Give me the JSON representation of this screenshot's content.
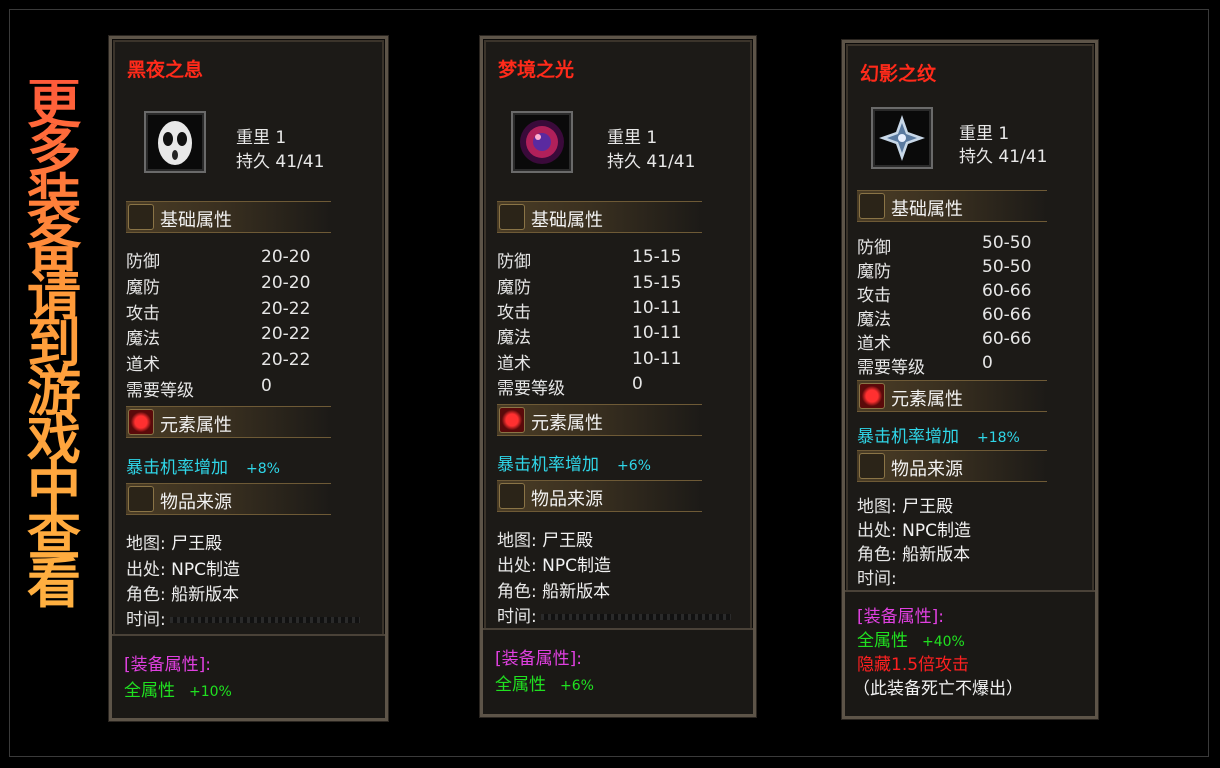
{
  "side_text": "更多装备请到游戏中查看",
  "labels": {
    "weight": "重里",
    "durability": "持久",
    "basic_attrs": "基础属性",
    "element_attrs": "元素属性",
    "item_source": "物品来源",
    "equip_attrs": "[装备属性]:",
    "all_attrs": "全属性",
    "crit_increase": "暴击机率增加",
    "map": "地图:",
    "origin": "出处:",
    "role": "角色:",
    "time": "时间:"
  },
  "stat_names": [
    "防御",
    "魔防",
    "攻击",
    "魔法",
    "道术",
    "需要等级"
  ],
  "items": [
    {
      "name": "黑夜之息",
      "icon": "skull-mask-icon",
      "weight": "1",
      "durability": "41/41",
      "stats": [
        "20-20",
        "20-20",
        "20-22",
        "20-22",
        "20-22",
        "0"
      ],
      "crit": "+8%",
      "map": "尸王殿",
      "origin": "NPC制造",
      "role": "船新版本",
      "time": "",
      "all_attrs": "+10%",
      "hidden_attack": "",
      "no_drop": ""
    },
    {
      "name": "梦境之光",
      "icon": "purple-orb-icon",
      "weight": "1",
      "durability": "41/41",
      "stats": [
        "15-15",
        "15-15",
        "10-11",
        "10-11",
        "10-11",
        "0"
      ],
      "crit": "+6%",
      "map": "尸王殿",
      "origin": "NPC制造",
      "role": "船新版本",
      "time": "",
      "all_attrs": "+6%",
      "hidden_attack": "",
      "no_drop": ""
    },
    {
      "name": "幻影之纹",
      "icon": "crystal-star-icon",
      "weight": "1",
      "durability": "41/41",
      "stats": [
        "50-50",
        "50-50",
        "60-66",
        "60-66",
        "60-66",
        "0"
      ],
      "crit": "+18%",
      "map": "尸王殿",
      "origin": "NPC制造",
      "role": "船新版本",
      "time": "",
      "all_attrs": "+40%",
      "hidden_attack": "隐藏1.5倍攻击",
      "no_drop": "（此装备死亡不爆出）"
    }
  ],
  "colors": {
    "title_red": "#ff2a1a",
    "crit_cyan": "#2fd6e8",
    "equip_magenta": "#e040e0",
    "attr_green": "#20e020"
  }
}
